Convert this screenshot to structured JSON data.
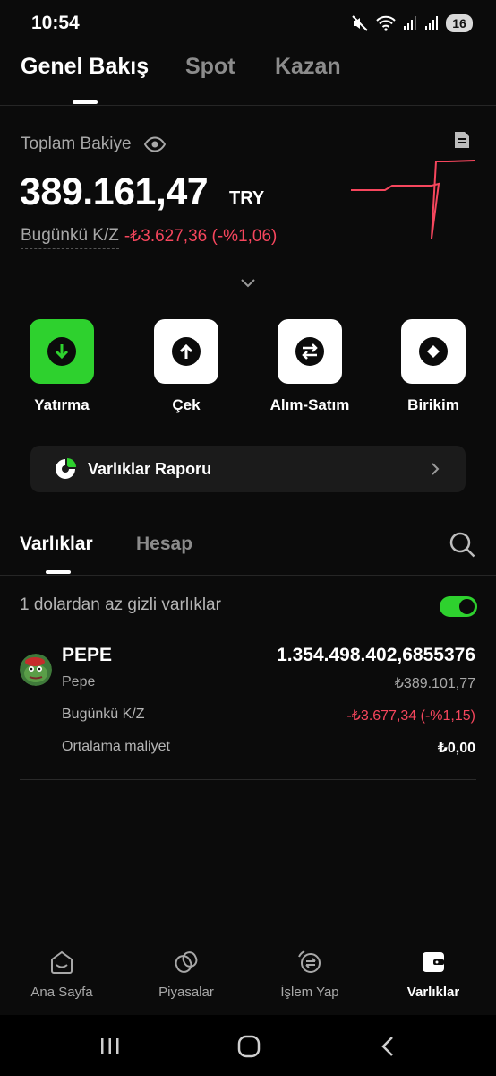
{
  "status_bar": {
    "time": "10:54",
    "battery": "16"
  },
  "top_tabs": [
    {
      "label": "Genel Bakış",
      "active": true
    },
    {
      "label": "Spot",
      "active": false
    },
    {
      "label": "Kazan",
      "active": false
    }
  ],
  "balance": {
    "label": "Toplam Bakiye",
    "amount": "389.161,47",
    "currency": "TRY",
    "pnl_label": "Bugünkü K/Z",
    "pnl_value": "-₺3.627,36 (-%1,06)"
  },
  "actions": [
    {
      "label": "Yatırma",
      "icon": "deposit-arrow-down-icon"
    },
    {
      "label": "Çek",
      "icon": "withdraw-arrow-up-icon"
    },
    {
      "label": "Alım-Satım",
      "icon": "swap-arrows-icon"
    },
    {
      "label": "Birikim",
      "icon": "savings-diamond-icon"
    }
  ],
  "report_banner": {
    "label": "Varlıklar Raporu"
  },
  "asset_tabs": [
    {
      "label": "Varlıklar",
      "active": true
    },
    {
      "label": "Hesap",
      "active": false
    }
  ],
  "hide_small": {
    "label": "1 dolardan az gizli varlıklar",
    "enabled": true
  },
  "assets": [
    {
      "symbol": "PEPE",
      "name": "Pepe",
      "amount": "1.354.498.402,6855376",
      "value": "₺389.101,77",
      "pnl_label": "Bugünkü K/Z",
      "pnl_value": "-₺3.677,34 (-%1,15)",
      "cost_label": "Ortalama maliyet",
      "cost_value": "₺0,00"
    }
  ],
  "bottom_nav": [
    {
      "label": "Ana Sayfa",
      "icon": "home-icon",
      "active": false
    },
    {
      "label": "Piyasalar",
      "icon": "markets-coins-icon",
      "active": false
    },
    {
      "label": "İşlem Yap",
      "icon": "trade-icon",
      "active": false
    },
    {
      "label": "Varlıklar",
      "icon": "wallet-icon",
      "active": true
    }
  ],
  "colors": {
    "accent_green": "#2ed12e",
    "loss_red": "#f6465d",
    "background": "#0b0b0b"
  }
}
